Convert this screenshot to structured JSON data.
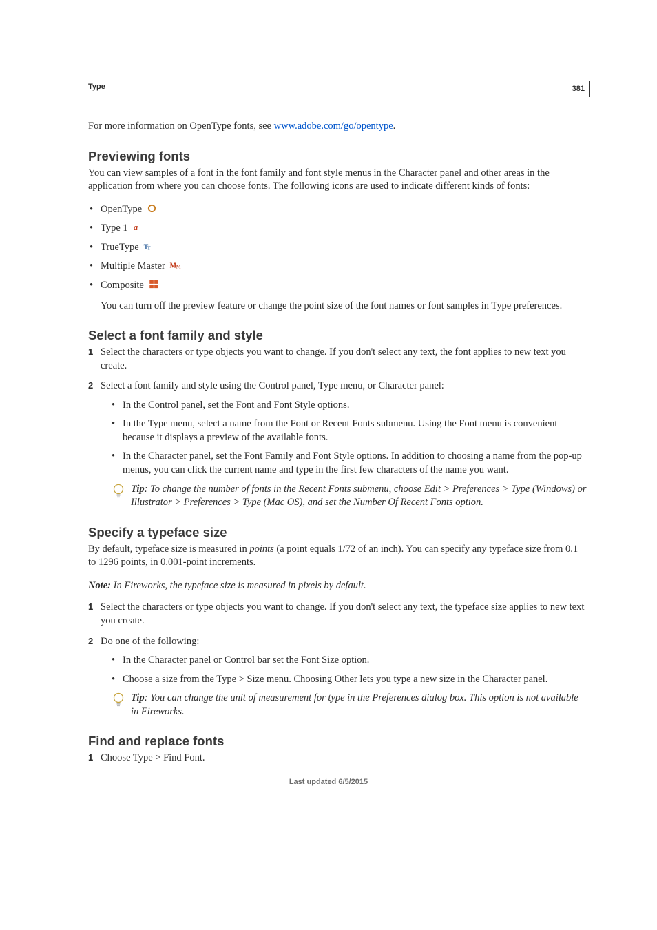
{
  "page_number": "381",
  "chapter": "Type",
  "intro": {
    "pre": "For more information on OpenType fonts, see ",
    "link_text": "www.adobe.com/go/opentype",
    "post": "."
  },
  "sections": {
    "preview": {
      "heading": "Previewing fonts",
      "para": "You can view samples of a font in the font family and font style menus in the Character panel and other areas in the application from where you can choose fonts. The following icons are used to indicate different kinds of fonts:",
      "types": [
        "OpenType",
        "Type 1",
        "TrueType",
        "Multiple Master",
        "Composite"
      ],
      "after": "You can turn off the preview feature or change the point size of the font names or font samples in Type preferences."
    },
    "select": {
      "heading": "Select a font family and style",
      "step1": "Select the characters or type objects you want to change. If you don't select any text, the font applies to new text you create.",
      "step2": "Select a font family and style using the Control panel, Type menu, or Character panel:",
      "sub": [
        "In the Control panel, set the Font and Font Style options.",
        "In the Type menu, select a name from the Font or Recent Fonts submenu. Using the Font menu is convenient because it displays a preview of the available fonts.",
        "In the Character panel, set the Font Family and Font Style options. In addition to choosing a name from the pop-up menus, you can click the current name and type in the first few characters of the name you want."
      ],
      "tip_label": "Tip",
      "tip": ": To change the number of fonts in the Recent Fonts submenu, choose Edit > Preferences > Type (Windows) or Illustrator > Preferences > Type (Mac OS), and set the Number Of Recent Fonts option."
    },
    "size": {
      "heading": "Specify a typeface size",
      "para_pre": "By default, typeface size is measured in ",
      "para_em": "points",
      "para_post": " (a point equals 1/72 of an inch). You can specify any typeface size from 0.1 to 1296 points, in 0.001-point increments.",
      "note_label": "Note:",
      "note": " In Fireworks, the typeface size is measured in pixels by default.",
      "step1": "Select the characters or type objects you want to change. If you don't select any text, the typeface size applies to new text you create.",
      "step2": "Do one of the following:",
      "sub": [
        "In the Character panel or Control bar set the Font Size option.",
        "Choose a size from the Type > Size menu. Choosing Other lets you type a new size in the Character panel."
      ],
      "tip_label": "Tip",
      "tip": ": You can change the unit of measurement for type in the Preferences dialog box. This option is not available in Fireworks."
    },
    "find": {
      "heading": "Find and replace fonts",
      "step1": "Choose Type > Find Font."
    }
  },
  "footer": "Last updated 6/5/2015"
}
